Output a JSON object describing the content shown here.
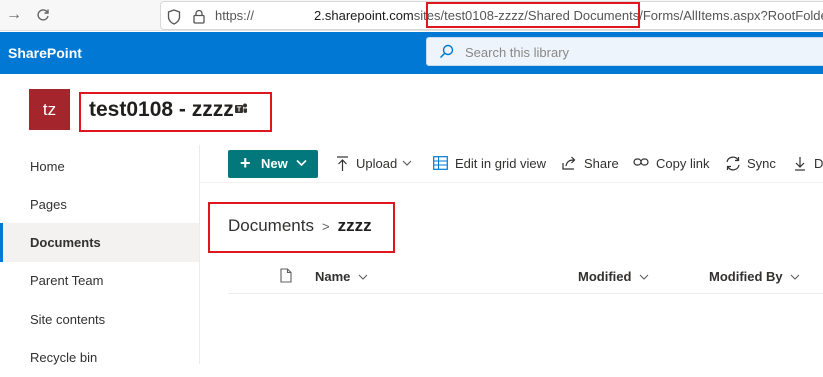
{
  "browser": {
    "url_prefix": "https://",
    "url_host": "2.sharepoint.com",
    "url_path_highlight": "sites/test0108-zzzz/Shared Documents",
    "url_rest": "/Forms/AllItems.aspx?RootFolder=%"
  },
  "suite": {
    "brand": "SharePoint",
    "search_placeholder": "Search this library"
  },
  "site": {
    "logo_initials": "tz",
    "title": "test0108 - zzzz"
  },
  "nav": {
    "items": [
      "Home",
      "Pages",
      "Documents",
      "Parent Team",
      "Site contents",
      "Recycle bin"
    ],
    "selected": "Documents"
  },
  "commands": {
    "new": "New",
    "upload": "Upload",
    "grid": "Edit in grid view",
    "share": "Share",
    "copy_link": "Copy link",
    "sync": "Sync",
    "download": "D"
  },
  "breadcrumb": {
    "root": "Documents",
    "current": "zzzz"
  },
  "list": {
    "columns": [
      "Name",
      "Modified",
      "Modified By"
    ]
  },
  "colors": {
    "suite_bar": "#0078d4",
    "new_button": "#03787c",
    "site_logo": "#a4262c",
    "highlight": "#e0161e"
  }
}
